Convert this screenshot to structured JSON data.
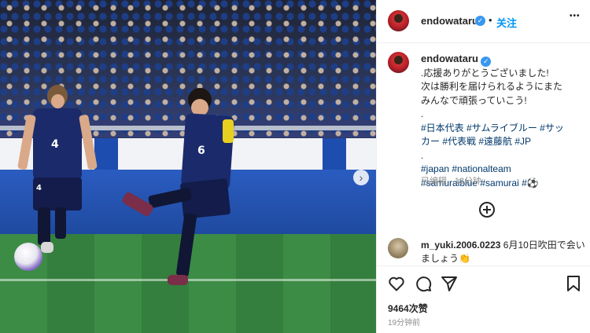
{
  "post": {
    "author": "endowataru",
    "follow_label": "关注",
    "separator": "•",
    "more_label": "•••",
    "next_label": "›"
  },
  "photo": {
    "player_main_number": "6",
    "player_left_number": "4",
    "player_left_shorts_number": "4"
  },
  "caption": {
    "author": "endowataru",
    "line_1": ".応援ありがとうございました!",
    "line_2": "次は勝利を届けられるようにまた",
    "line_3": "みんなで頑張っていこう!",
    "line_4": ".",
    "line_5": "#日本代表 #サムライブルー #サッ",
    "line_6": "カー #代表戦 #遠藤航 #JP",
    "line_7": ".",
    "line_8": "#japan #nationalteam",
    "line_9": "#samuraiblue #samurai #⚽"
  },
  "meta": {
    "edited": "已编辑",
    "separator": "·",
    "time": "18分钟"
  },
  "comment": {
    "user": "m_yuki.2006.0223",
    "text_1": "6月10日吹田で会い",
    "text_2": "ましょう👏"
  },
  "actions": {
    "likes": "9464次赞",
    "timestamp": "19分钟前"
  },
  "colors": {
    "accent": "#0095f6",
    "hashtag": "#00376b",
    "verified": "#3897f0"
  }
}
